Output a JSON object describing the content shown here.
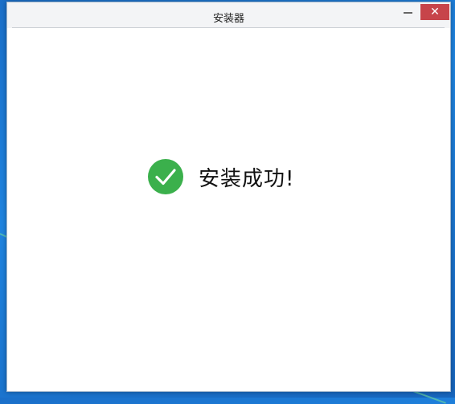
{
  "window": {
    "title": "安装器",
    "close_symbol": "✕"
  },
  "status": {
    "message": "安装成功!",
    "icon": "check-circle-icon",
    "icon_color": "#3bb04c"
  },
  "colors": {
    "close_button": "#c7444a",
    "desktop": "#1f84e0"
  }
}
